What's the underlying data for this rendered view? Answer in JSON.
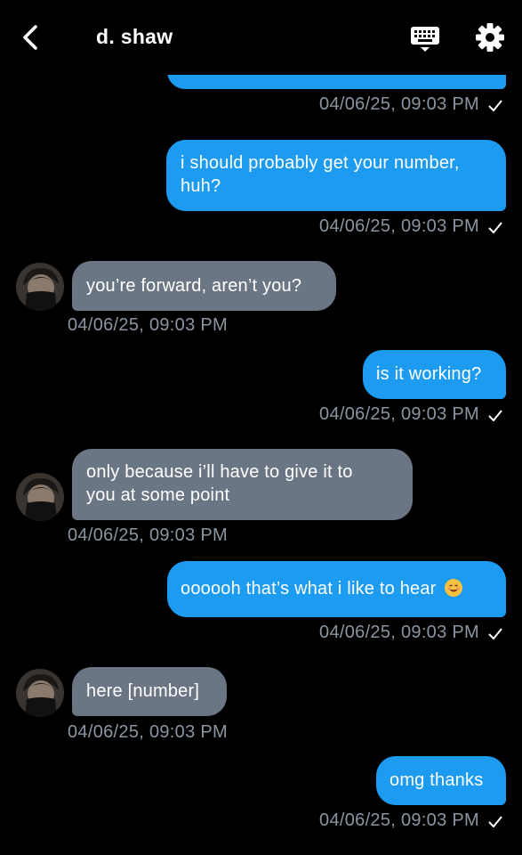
{
  "header": {
    "contact_name": "d. shaw"
  },
  "messages": [
    {
      "direction": "outgoing",
      "text": "",
      "timestamp": "04/06/25, 09:03 PM",
      "read": true
    },
    {
      "direction": "outgoing",
      "text": "i should probably get your number, huh?",
      "line1": "i should probably get your number,",
      "line2": "huh?",
      "timestamp": "04/06/25, 09:03 PM",
      "read": true
    },
    {
      "direction": "incoming",
      "text": "you’re forward, aren’t you?",
      "timestamp": "04/06/25, 09:03 PM"
    },
    {
      "direction": "outgoing",
      "text": "is it working?",
      "timestamp": "04/06/25, 09:03 PM",
      "read": true
    },
    {
      "direction": "incoming",
      "text": "only because i’ll have to give it to you at some point",
      "line1": "only because i’ll have to give it to",
      "line2": "you at some point",
      "timestamp": "04/06/25, 09:03 PM"
    },
    {
      "direction": "outgoing",
      "text": "oooooh that’s what i like to hear",
      "emoji": "smiling-face",
      "timestamp": "04/06/25, 09:03 PM",
      "read": true
    },
    {
      "direction": "incoming",
      "text": "here [number]",
      "timestamp": "04/06/25, 09:03 PM"
    },
    {
      "direction": "outgoing",
      "text": "omg thanks",
      "timestamp": "04/06/25, 09:03 PM",
      "read": true
    }
  ],
  "colors": {
    "outgoing_bubble": "#1d9bf0",
    "incoming_bubble": "#6b7684",
    "timestamp": "#8b95a1",
    "background": "#000000"
  },
  "icons": [
    "back-chevron-icon",
    "keyboard-icon",
    "gear-icon",
    "read-check-icon"
  ]
}
